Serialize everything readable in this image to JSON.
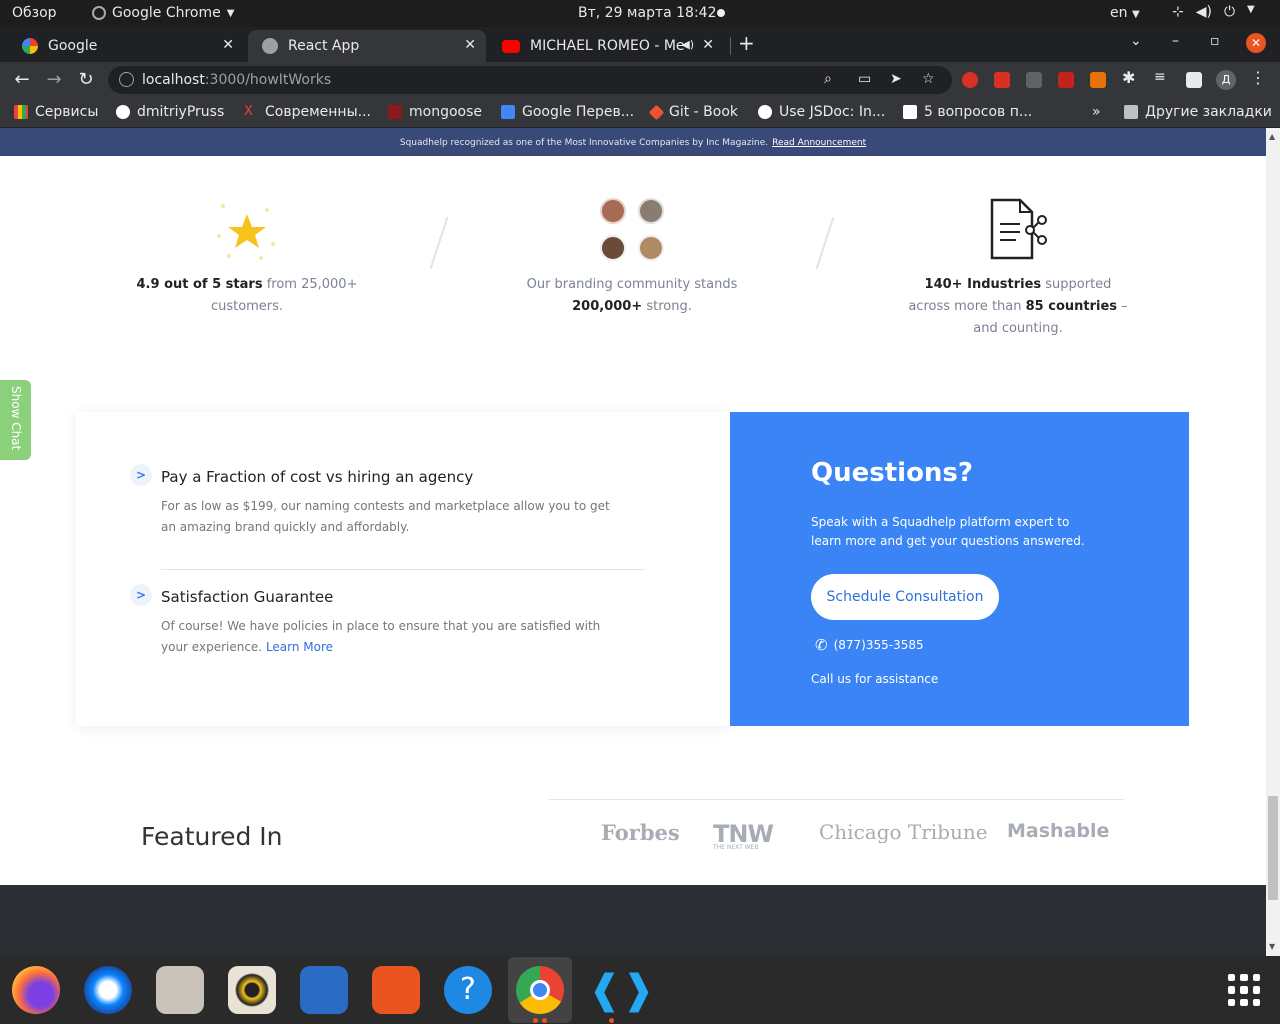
{
  "system_bar": {
    "overview": "Обзор",
    "app_name": "Google Chrome",
    "datetime": "Вт, 29 марта  18:42",
    "lang": "en"
  },
  "tabs": [
    {
      "title": "Google",
      "active": false
    },
    {
      "title": "React App",
      "active": true
    },
    {
      "title": "MICHAEL ROMEO - Me",
      "active": false
    }
  ],
  "address_bar": {
    "host": "localhost",
    "path": ":3000/howItWorks"
  },
  "bookmarks": [
    {
      "label": "Сервисы",
      "icon": "apps-grid-icon"
    },
    {
      "label": "dmitriyPruss",
      "icon": "github-icon"
    },
    {
      "label": "Современны...",
      "icon": "bookmark-x-icon"
    },
    {
      "label": "mongoose",
      "icon": "mongoose-icon"
    },
    {
      "label": "Google Перев...",
      "icon": "translate-icon"
    },
    {
      "label": "Git - Book",
      "icon": "git-icon"
    },
    {
      "label": "Use JSDoc: In...",
      "icon": "globe-icon"
    },
    {
      "label": "5 вопросов п...",
      "icon": "medium-icon"
    },
    {
      "label": "»",
      "icon": "more-icon"
    },
    {
      "label": "Другие закладки",
      "icon": "folder-icon"
    }
  ],
  "page": {
    "announcement": {
      "text": "Squadhelp recognized as one of the Most Innovative Companies by Inc Magazine.",
      "link": "Read Announcement"
    },
    "stats": [
      {
        "bold1": "4.9 out of 5 stars",
        "rest1": " from 25,000+",
        "line2": "customers."
      },
      {
        "line1": "Our branding community stands",
        "bold2": "200,000+",
        "rest2": " strong."
      },
      {
        "bold1": "140+ Industries",
        "rest1": " supported",
        "pre2": "across more than ",
        "bold2": "85 countries",
        "rest2": " –",
        "line3": "and counting."
      }
    ],
    "show_chat": "Show Chat",
    "benefits": [
      {
        "title": "Pay a Fraction of cost vs hiring an agency",
        "text": "For as low as $199, our naming contests and marketplace allow you to get an amazing brand quickly and affordably."
      },
      {
        "title": "Satisfaction Guarantee",
        "text": "Of course! We have policies in place to ensure that you are satisfied with your experience.",
        "link": "Learn More"
      }
    ],
    "questions": {
      "title": "Questions?",
      "subtitle": "Speak with a Squadhelp platform expert to learn more and get your questions answered.",
      "button": "Schedule Consultation",
      "phone": "(877)355-3585",
      "call_text": "Call us for assistance"
    },
    "featured": {
      "title": "Featured In",
      "logos": [
        "Forbes",
        "TNW",
        "THE NEXT WEB",
        "Chicago Tribune",
        "Mashable"
      ]
    }
  },
  "colors": {
    "accent_blue": "#3a84f5",
    "announcement_bg": "#3a4a78",
    "show_chat_green": "#8bd17c",
    "ubuntu_orange": "#e95420"
  }
}
